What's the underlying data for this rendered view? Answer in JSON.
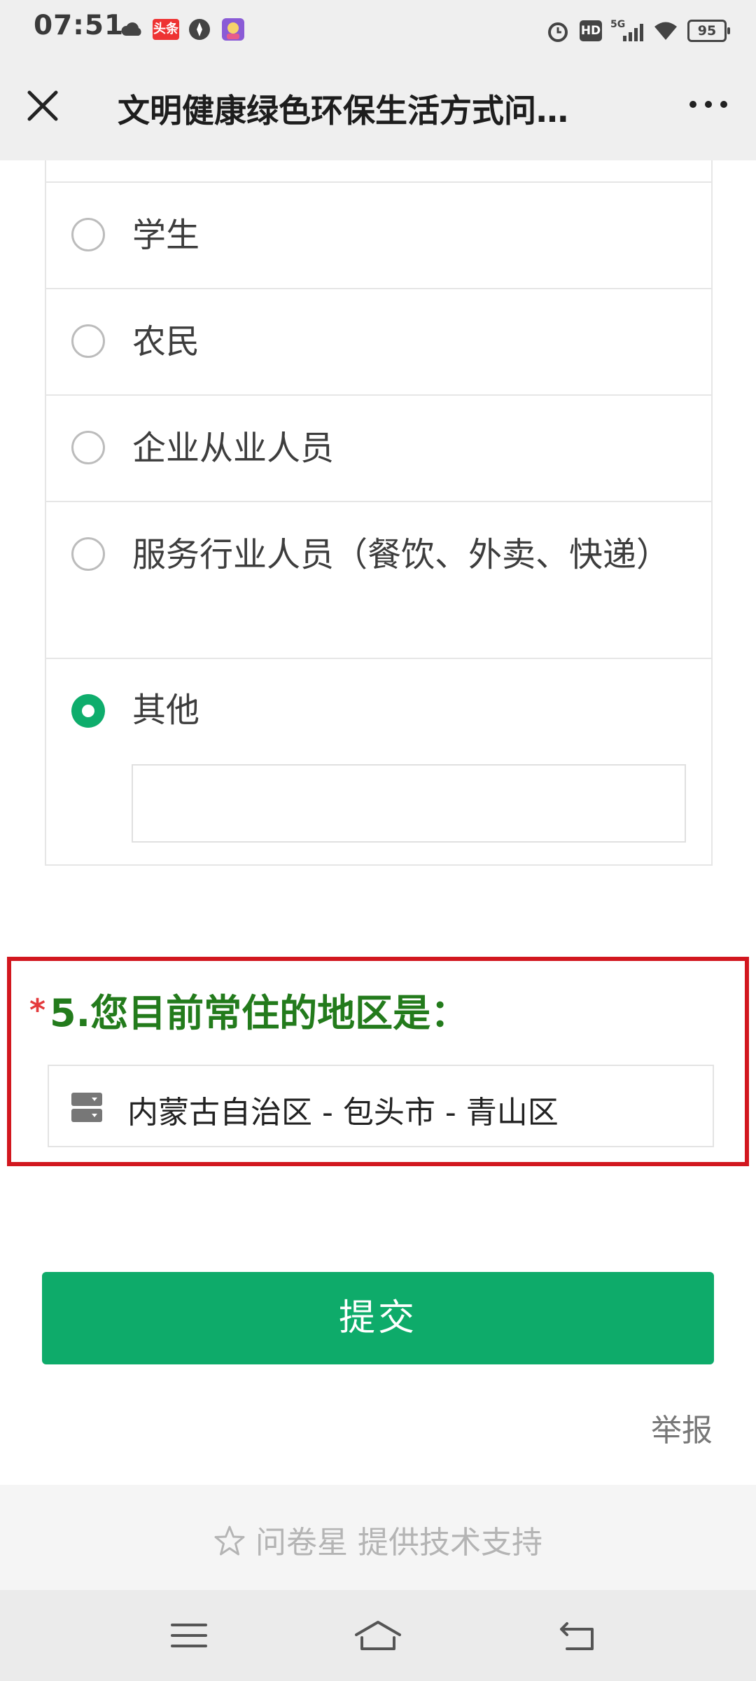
{
  "status_bar": {
    "time": "07:51",
    "left_icons": [
      "cloud-icon",
      "toutiao-news-icon",
      "compass-icon",
      "app-avatar-icon"
    ],
    "news_badge": "头条",
    "right_icons": [
      "alarm-icon",
      "hd-icon",
      "5g-signal-icon",
      "wifi-icon",
      "battery-icon"
    ],
    "hd_label": "HD",
    "network": "5G",
    "battery": "95"
  },
  "nav": {
    "title": "文明健康绿色环保生活方式问…",
    "close_icon": "close-icon",
    "more_icon": "more-icon"
  },
  "question4": {
    "options": [
      {
        "label": "学生",
        "selected": false
      },
      {
        "label": "农民",
        "selected": false
      },
      {
        "label": "企业从业人员",
        "selected": false
      },
      {
        "label": "服务行业人员（餐饮、外卖、快递）",
        "selected": false
      },
      {
        "label": "其他",
        "selected": true
      }
    ],
    "other_input_value": ""
  },
  "question5": {
    "required_mark": "*",
    "title": "5.您目前常住的地区是：",
    "region_value": "内蒙古自治区 - 包头市 - 青山区"
  },
  "actions": {
    "submit_label": "提交",
    "report_label": "举报"
  },
  "footer": {
    "text": "问卷星 提供技术支持"
  },
  "colors": {
    "accent_green": "#0eab6a",
    "title_green": "#237b1c",
    "highlight_red": "#d2171f",
    "required_red": "#e4393c"
  }
}
